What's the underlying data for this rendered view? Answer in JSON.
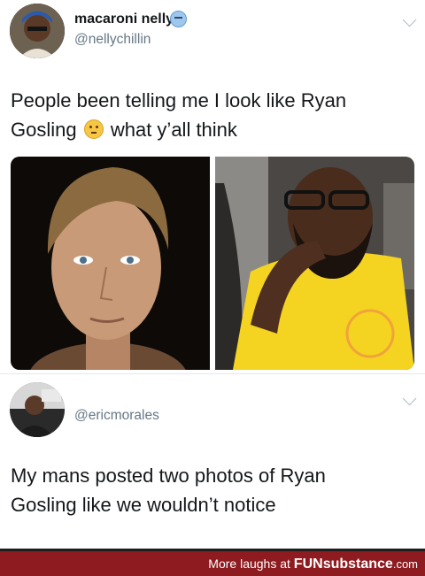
{
  "tweet1": {
    "display_name": "macaroni nelly",
    "name_emoji": "grimacing-face-emoji",
    "handle": "@nellychillin",
    "text_line1": "People been telling me I look like Ryan",
    "text_line2_a": "Gosling",
    "text_emoji": "thinking-face-emoji",
    "text_line2_b": "what y’all think"
  },
  "tweet2": {
    "handle": "@ericmorales",
    "text_line1": "My mans posted two photos of Ryan",
    "text_line2": "Gosling like we wouldn’t notice"
  },
  "footer": {
    "prefix": "More laughs at ",
    "brand_fun": "FUN",
    "brand_substance": "substance",
    "domain": ".com"
  },
  "colors": {
    "footer_bg": "#8e1b1f",
    "handle": "#657786",
    "shirt": "#f5d321"
  }
}
